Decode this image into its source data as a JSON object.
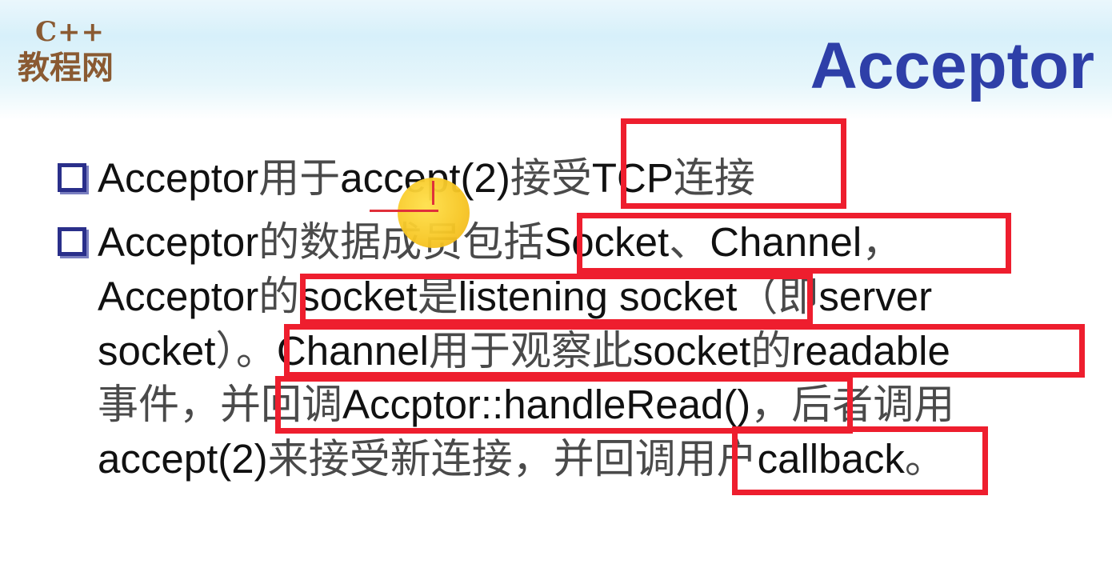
{
  "logo": {
    "top": "C++",
    "bottom": "教程网"
  },
  "title": "Acceptor",
  "bullets": [
    {
      "lines": [
        [
          {
            "t": "Acceptor",
            "cn": false
          },
          {
            "t": "用于",
            "cn": true
          },
          {
            "t": "accept(2)",
            "cn": false
          },
          {
            "t": "接受",
            "cn": true
          },
          {
            "t": "TCP",
            "cn": false
          },
          {
            "t": "连接",
            "cn": true
          }
        ]
      ]
    },
    {
      "lines": [
        [
          {
            "t": "Acceptor",
            "cn": false
          },
          {
            "t": "的数据成员包括",
            "cn": true
          },
          {
            "t": "Socket",
            "cn": false
          },
          {
            "t": "、",
            "cn": true
          },
          {
            "t": "Channel",
            "cn": false
          },
          {
            "t": "，",
            "cn": true
          }
        ],
        [
          {
            "t": "Acceptor",
            "cn": false
          },
          {
            "t": "的",
            "cn": true
          },
          {
            "t": "socket",
            "cn": false
          },
          {
            "t": "是",
            "cn": true
          },
          {
            "t": "listening socket",
            "cn": false
          },
          {
            "t": "（即",
            "cn": true
          },
          {
            "t": "server",
            "cn": false
          }
        ],
        [
          {
            "t": "socket",
            "cn": false
          },
          {
            "t": "）。",
            "cn": true
          },
          {
            "t": "Channel",
            "cn": false
          },
          {
            "t": "用于观察此",
            "cn": true
          },
          {
            "t": "socket",
            "cn": false
          },
          {
            "t": "的",
            "cn": true
          },
          {
            "t": "readable",
            "cn": false
          }
        ],
        [
          {
            "t": "事件，并回调",
            "cn": true
          },
          {
            "t": "Accptor::handleRead()",
            "cn": false
          },
          {
            "t": "，后者调用",
            "cn": true
          }
        ],
        [
          {
            "t": "accept(2)",
            "cn": false
          },
          {
            "t": "来接受新连接，并回调用户",
            "cn": true
          },
          {
            "t": "callback",
            "cn": false
          },
          {
            "t": "。",
            "cn": true
          }
        ]
      ]
    }
  ],
  "annotation_color": "#ee1e2e",
  "cursor_icon": "yellow-pointer-circle"
}
